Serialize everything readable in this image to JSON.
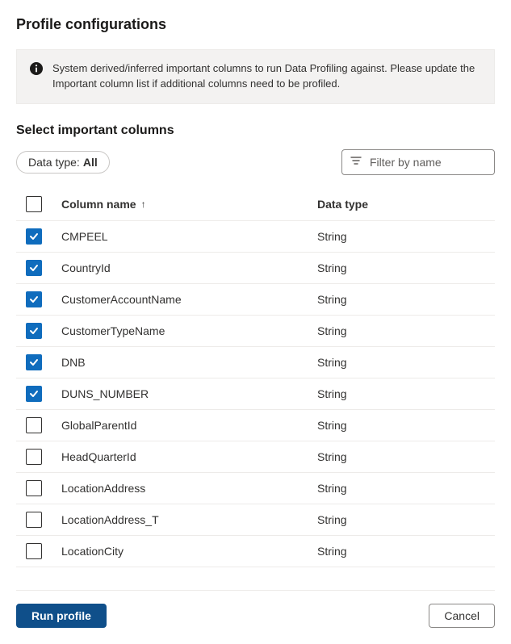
{
  "page": {
    "title": "Profile configurations",
    "info_message": "System derived/inferred important columns to run Data Profiling against. Please update the Important column list if additional columns need to be profiled.",
    "section_title": "Select important columns"
  },
  "filters": {
    "data_type_label": "Data type:",
    "data_type_value": "All",
    "filter_placeholder": "Filter by name"
  },
  "table": {
    "header_name": "Column name",
    "header_type": "Data type",
    "rows": [
      {
        "name": "CMPEEL",
        "type": "String",
        "checked": true
      },
      {
        "name": "CountryId",
        "type": "String",
        "checked": true
      },
      {
        "name": "CustomerAccountName",
        "type": "String",
        "checked": true
      },
      {
        "name": "CustomerTypeName",
        "type": "String",
        "checked": true
      },
      {
        "name": "DNB",
        "type": "String",
        "checked": true
      },
      {
        "name": "DUNS_NUMBER",
        "type": "String",
        "checked": true
      },
      {
        "name": "GlobalParentId",
        "type": "String",
        "checked": false
      },
      {
        "name": "HeadQuarterId",
        "type": "String",
        "checked": false
      },
      {
        "name": "LocationAddress",
        "type": "String",
        "checked": false
      },
      {
        "name": "LocationAddress_T",
        "type": "String",
        "checked": false
      },
      {
        "name": "LocationCity",
        "type": "String",
        "checked": false
      }
    ]
  },
  "footer": {
    "run_label": "Run profile",
    "cancel_label": "Cancel"
  }
}
